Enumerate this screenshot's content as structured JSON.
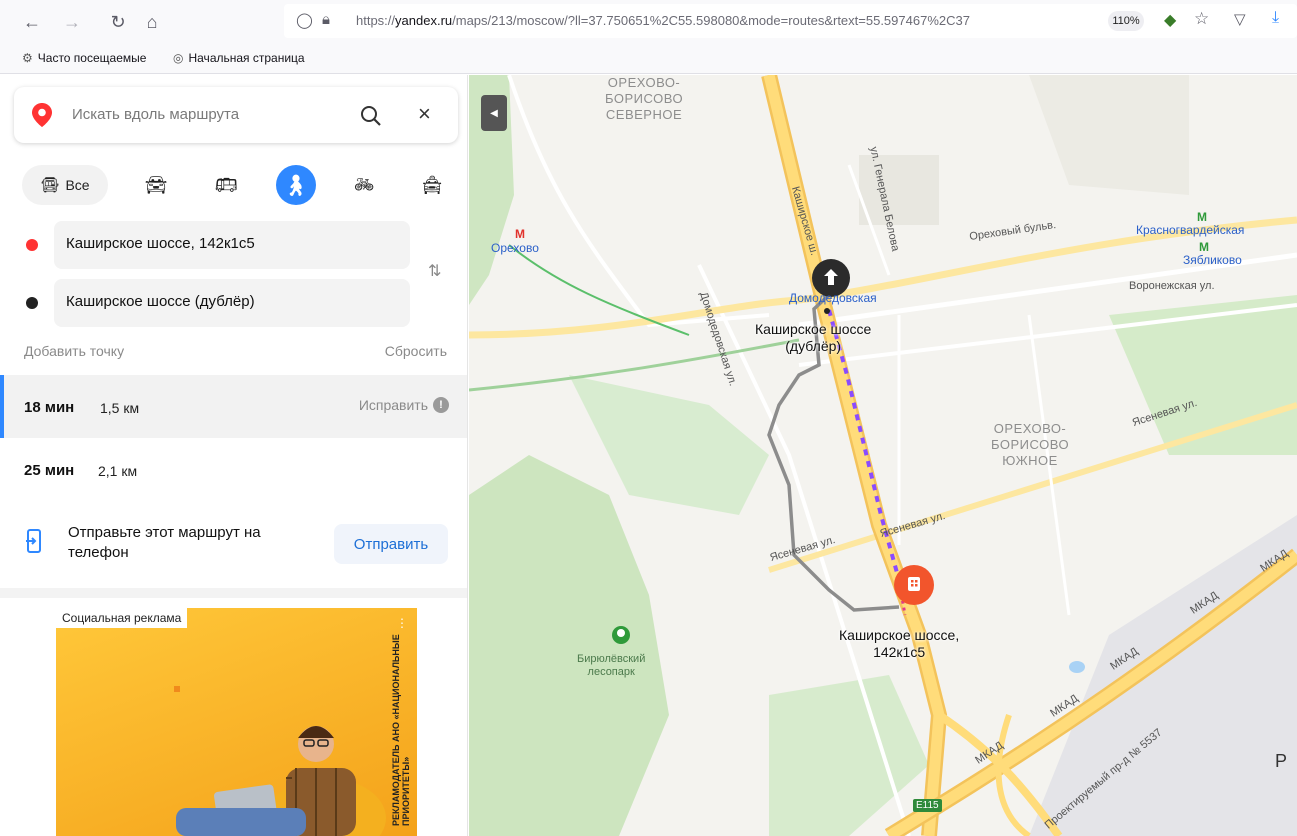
{
  "browser": {
    "url_prefix": "https://",
    "url_domain": "yandex.ru",
    "url_rest": "/maps/213/moscow/?ll=37.750651%2C55.598080&mode=routes&rtext=55.597467%2C37",
    "zoom": "110%",
    "bookmarks": [
      "Часто посещаемые",
      "Начальная страница"
    ]
  },
  "sidebar": {
    "search_placeholder": "Искать вдоль маршрута",
    "mode_all_label": "Все",
    "from": "Каширское шоссе, 142к1с5",
    "to": "Каширское шоссе (дублёр)",
    "add_point": "Добавить точку",
    "reset": "Сбросить",
    "routes": [
      {
        "time": "18 мин",
        "distance": "1,5 км",
        "fix": "Исправить"
      },
      {
        "time": "25 мин",
        "distance": "2,1 км"
      }
    ],
    "send_text": "Отправьте этот маршрут на телефон",
    "send_button": "Отправить"
  },
  "ad": {
    "label": "Социальная реклама",
    "vertical_text": "РЕКЛАМОДАТЕЛЬ АНО «НАЦИОНАЛЬНЫЕ ПРИОРИТЕТЫ»"
  },
  "map": {
    "districts": [
      {
        "text": "ОРЕХОВО-\nБОРИСОВО\nСЕВЕРНОЕ"
      },
      {
        "text": "ОРЕХОВО-\nБОРИСОВО\nЮЖНОЕ"
      }
    ],
    "metro": [
      "Орехово",
      "Домодедовская",
      "Красногвардейская",
      "Зябликово"
    ],
    "streets": [
      "Каширское ш.",
      "ул. Генерала Белова",
      "Ореховый бульв.",
      "Воронежская ул.",
      "Домодедовская ул.",
      "Ясеневая ул.",
      "Ясеневая ул.",
      "Ясеневая ул.",
      "МКАД",
      "МКАД",
      "МКАД",
      "МКАД",
      "МКАД",
      "Проектируемый пр-д № 5537",
      "E115"
    ],
    "park": "Бирюлёвский\nлесопарк",
    "route_end_label": "Каширское шоссе\n(дублёр)",
    "route_start_label": "Каширское шоссе,\n142к1с5",
    "letter_right": "Р"
  },
  "colors": {
    "accent": "#2f88ff",
    "route_walk": "#8a4bff",
    "route_alt": "#8c8c8c",
    "start_marker": "#f2552c"
  }
}
